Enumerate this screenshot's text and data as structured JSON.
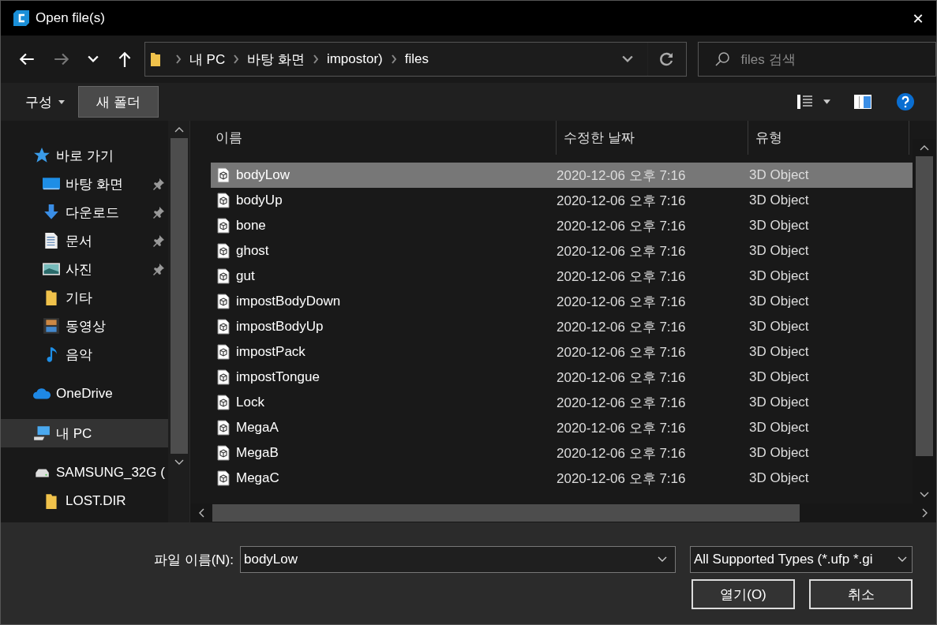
{
  "window": {
    "title": "Open file(s)",
    "close": "✕"
  },
  "nav": {
    "breadcrumb": [
      "내 PC",
      "바탕 화면",
      "impostor)",
      "files"
    ],
    "search": {
      "placeholder": "files 검색"
    }
  },
  "toolbar": {
    "organize": "구성",
    "new_folder": "새 폴더"
  },
  "sidebar": {
    "items": [
      {
        "label": "바로 가기",
        "kind": "star",
        "selected": false,
        "children": [
          {
            "label": "바탕 화면",
            "kind": "desktop",
            "pinned": true,
            "selected": false
          },
          {
            "label": "다운로드",
            "kind": "download",
            "pinned": true,
            "selected": false
          },
          {
            "label": "문서",
            "kind": "document",
            "pinned": true,
            "selected": false
          },
          {
            "label": "사진",
            "kind": "pictures",
            "pinned": true,
            "selected": false
          },
          {
            "label": "기타",
            "kind": "folder",
            "pinned": false,
            "selected": false
          },
          {
            "label": "동영상",
            "kind": "video",
            "pinned": false,
            "selected": false
          },
          {
            "label": "음악",
            "kind": "music",
            "pinned": false,
            "selected": false
          }
        ]
      },
      {
        "label": "OneDrive",
        "kind": "cloud",
        "selected": false
      },
      {
        "label": "내 PC",
        "kind": "pc",
        "selected": true
      },
      {
        "label": "SAMSUNG_32G (",
        "kind": "drive",
        "selected": false,
        "children": [
          {
            "label": "LOST.DIR",
            "kind": "folder",
            "pinned": false,
            "selected": false
          }
        ]
      }
    ]
  },
  "table": {
    "columns": [
      "이름",
      "수정한 날짜",
      "유형"
    ],
    "rows": [
      {
        "name": "bodyLow",
        "modified": "2020-12-06 오후 7:16",
        "type": "3D Object",
        "selected": true
      },
      {
        "name": "bodyUp",
        "modified": "2020-12-06 오후 7:16",
        "type": "3D Object",
        "selected": false
      },
      {
        "name": "bone",
        "modified": "2020-12-06 오후 7:16",
        "type": "3D Object",
        "selected": false
      },
      {
        "name": "ghost",
        "modified": "2020-12-06 오후 7:16",
        "type": "3D Object",
        "selected": false
      },
      {
        "name": "gut",
        "modified": "2020-12-06 오후 7:16",
        "type": "3D Object",
        "selected": false
      },
      {
        "name": "impostBodyDown",
        "modified": "2020-12-06 오후 7:16",
        "type": "3D Object",
        "selected": false
      },
      {
        "name": "impostBodyUp",
        "modified": "2020-12-06 오후 7:16",
        "type": "3D Object",
        "selected": false
      },
      {
        "name": "impostPack",
        "modified": "2020-12-06 오후 7:16",
        "type": "3D Object",
        "selected": false
      },
      {
        "name": "impostTongue",
        "modified": "2020-12-06 오후 7:16",
        "type": "3D Object",
        "selected": false
      },
      {
        "name": "Lock",
        "modified": "2020-12-06 오후 7:16",
        "type": "3D Object",
        "selected": false
      },
      {
        "name": "MegaA",
        "modified": "2020-12-06 오후 7:16",
        "type": "3D Object",
        "selected": false
      },
      {
        "name": "MegaB",
        "modified": "2020-12-06 오후 7:16",
        "type": "3D Object",
        "selected": false
      },
      {
        "name": "MegaC",
        "modified": "2020-12-06 오후 7:16",
        "type": "3D Object",
        "selected": false
      }
    ]
  },
  "footer": {
    "filename_label": "파일 이름(N):",
    "filename": "bodyLow",
    "filter": "All Supported Types (*.ufp *.gi",
    "open": "열기(O)",
    "cancel": "취소"
  }
}
